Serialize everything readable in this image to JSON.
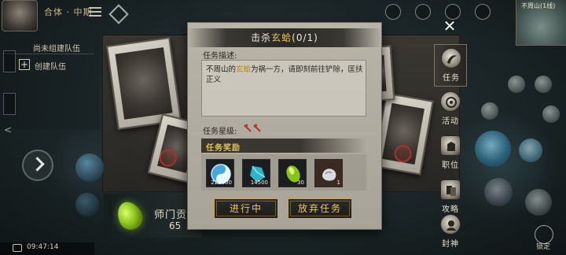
{
  "hud": {
    "level_text": "合体 · 中期",
    "clock": "09:47:14",
    "minimap_label": "不周山(1线)",
    "lock_label": "锁定"
  },
  "team": {
    "no_team": "尚未组建队伍",
    "create_team": "创建队伍"
  },
  "top_right": {
    "icon_labels": [
      "",
      "",
      "",
      ""
    ]
  },
  "contribution": {
    "label": "师门贡献",
    "value": "65"
  },
  "side_nav": {
    "items": [
      {
        "label": "任务",
        "icon": "quest-icon",
        "active": true
      },
      {
        "label": "活动",
        "icon": "activity-icon",
        "active": false
      },
      {
        "label": "职位",
        "icon": "rank-icon",
        "active": false
      },
      {
        "label": "攻略",
        "icon": "guide-icon",
        "active": false
      },
      {
        "label": "封神",
        "icon": "deity-icon",
        "active": false
      }
    ]
  },
  "dialog": {
    "title_prefix": "击杀",
    "title_target": "玄蛤",
    "title_progress": "(0/1)",
    "desc_label": "任务描述:",
    "desc_before": "不周山的",
    "desc_target": "玄蛤",
    "desc_after": "为祸一方，请即刻前往铲除，匡扶正义",
    "star_label": "任务星级:",
    "star_count": 2,
    "reward_header": "任务奖励",
    "rewards": [
      {
        "icon": "taiji-orb-icon",
        "count": "222000"
      },
      {
        "icon": "cyan-crystal-icon",
        "count": "14500"
      },
      {
        "icon": "green-jade-icon",
        "count": "30"
      },
      {
        "icon": "silver-ore-icon",
        "count": "1"
      }
    ],
    "btn_in_progress": "进行中",
    "btn_abandon": "放弃任务"
  },
  "colors": {
    "accent_gold": "#e3c15a",
    "highlight_text": "#b8891c",
    "panel_bg": "#b8b4a8"
  }
}
